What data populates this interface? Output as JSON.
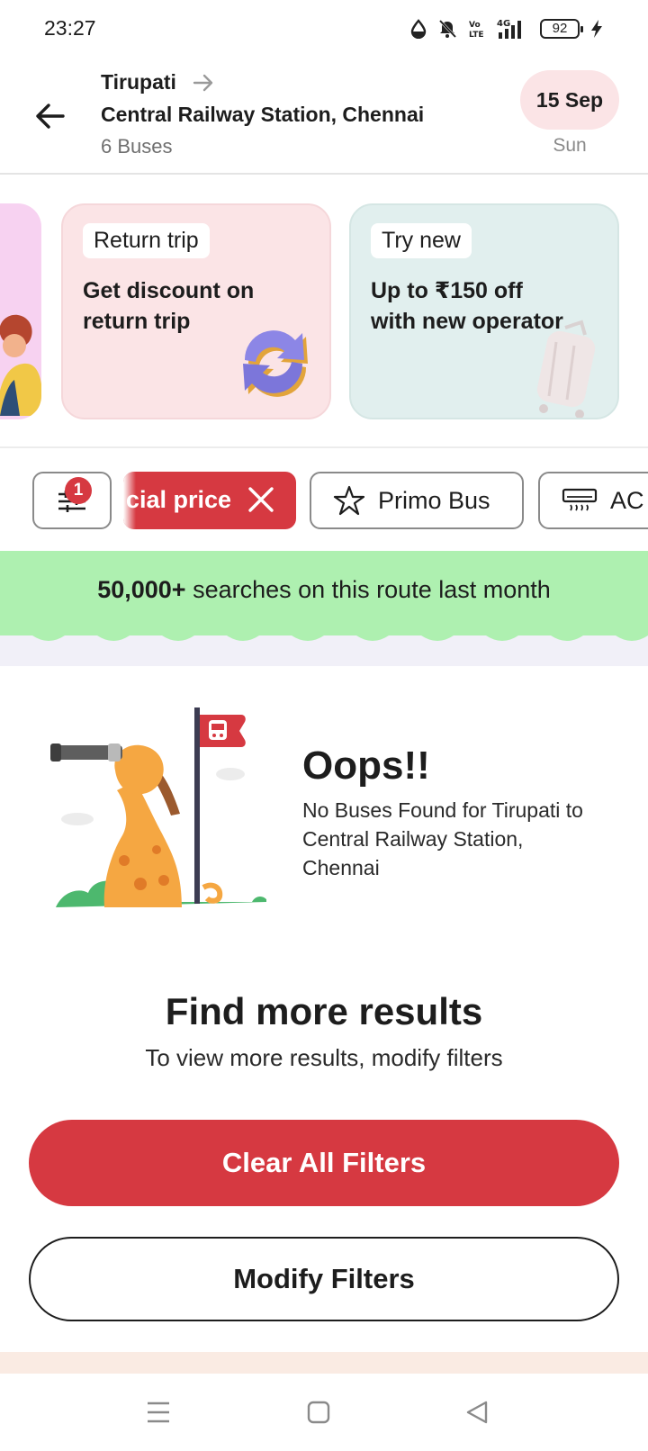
{
  "status_bar": {
    "time": "23:27",
    "battery": "92",
    "icons": [
      "data-saver-icon",
      "mute-icon",
      "volte-icon",
      "signal-4g-icon",
      "battery-icon",
      "charging-icon"
    ]
  },
  "header": {
    "from": "Tirupati",
    "to": "Central Railway Station, Chennai",
    "bus_count": "6 Buses",
    "date": "15 Sep",
    "day": "Sun"
  },
  "promos": [
    {
      "tag": "Return trip",
      "text": "Get discount on return trip"
    },
    {
      "tag": "Try new",
      "text": "Up to ₹150 off with new operator"
    }
  ],
  "filters": {
    "sort_badge": "1",
    "active_chip": "cial price",
    "chips": [
      "Primo Bus",
      "AC"
    ]
  },
  "banner": {
    "highlight": "50,000+",
    "text": " searches on this route last month"
  },
  "empty_state": {
    "title": "Oops!!",
    "message": "No Buses Found for Tirupati to Central Railway Station, Chennai"
  },
  "find_more": {
    "title": "Find more results",
    "subtitle": "To view more results, modify filters"
  },
  "buttons": {
    "clear": "Clear All Filters",
    "modify": "Modify Filters"
  },
  "colors": {
    "accent": "#d63941",
    "banner_green": "#aef0b0",
    "date_pill": "#fbe4e6"
  }
}
